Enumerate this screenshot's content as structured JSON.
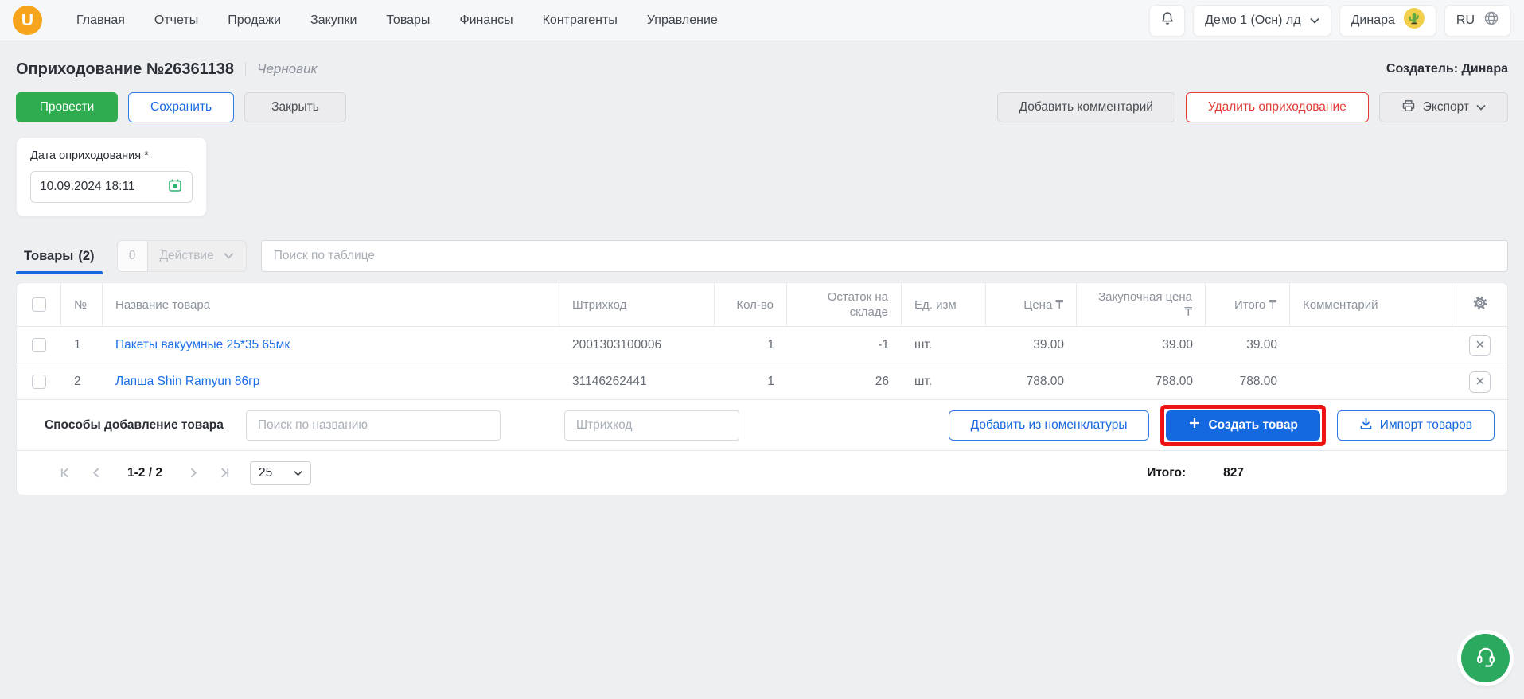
{
  "header": {
    "logo_letter": "U",
    "nav": [
      "Главная",
      "Отчеты",
      "Продажи",
      "Закупки",
      "Товары",
      "Финансы",
      "Контрагенты",
      "Управление"
    ],
    "company_selector": "Демо 1 (Осн) лд",
    "user_name": "Динара",
    "language": "RU"
  },
  "page": {
    "title": "Оприходование №26361138",
    "status": "Черновик",
    "creator": "Создатель: Динара",
    "actions": {
      "post": "Провести",
      "save": "Сохранить",
      "close": "Закрыть",
      "add_comment": "Добавить комментарий",
      "delete": "Удалить оприходование",
      "export": "Экспорт"
    },
    "date_field": {
      "label": "Дата оприходования *",
      "value": "10.09.2024 18:11"
    }
  },
  "tabs": {
    "products_label": "Товары",
    "products_count": "(2)",
    "selected_count": "0",
    "action_dropdown": "Действие",
    "table_search_placeholder": "Поиск по таблице"
  },
  "table": {
    "columns": [
      "№",
      "Название товара",
      "Штрихкод",
      "Кол-во",
      "Остаток на складе",
      "Ед. изм",
      "Цена ₸",
      "Закупочная цена ₸",
      "Итого ₸",
      "Комментарий"
    ],
    "rows": [
      {
        "num": "1",
        "name": "Пакеты вакуумные 25*35 65мк",
        "barcode": "2001303100006",
        "qty": "1",
        "stock": "-1",
        "unit": "шт.",
        "price": "39.00",
        "purchase_price": "39.00",
        "total": "39.00",
        "comment": ""
      },
      {
        "num": "2",
        "name": "Лапша Shin Ramyun 86гр",
        "barcode": "31146262441",
        "qty": "1",
        "stock": "26",
        "unit": "шт.",
        "price": "788.00",
        "purchase_price": "788.00",
        "total": "788.00",
        "comment": ""
      }
    ]
  },
  "add_row": {
    "label": "Способы добавление товара",
    "name_search_placeholder": "Поиск по названию",
    "barcode_placeholder": "Штрихкод",
    "add_from_catalog": "Добавить из номенклатуры",
    "create_product": "Создать товар",
    "import_products": "Импорт товаров"
  },
  "pagination": {
    "range": "1-2 / 2",
    "page_size": "25",
    "total_label": "Итого:",
    "total_value": "827"
  },
  "colors": {
    "accent_blue": "#1569e0",
    "green": "#2eac4f",
    "support_green": "#2ba95e",
    "calendar_green": "#2bb673",
    "red": "#e23b36",
    "highlight_red": "#ee1414",
    "logo_orange": "#f7a41d"
  }
}
